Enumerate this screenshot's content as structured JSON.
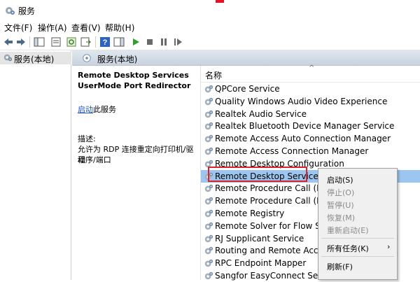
{
  "window": {
    "title": "服务"
  },
  "menu": [
    "文件(F)",
    "操作(A)",
    "查看(V)",
    "帮助(H)"
  ],
  "tree": {
    "node_label": "服务(本地)"
  },
  "pane": {
    "header_label": "服务(本地)"
  },
  "details": {
    "service_name_line1": "Remote Desktop Services",
    "service_name_line2": "UserMode Port Redirector",
    "start_link": "启动",
    "start_suffix": "此服务",
    "desc_label": "描述:",
    "desc_line1": "允许为 RDP 连接重定向打印机/驱动",
    "desc_line2": "程序/端口"
  },
  "list": {
    "column_name": "名称",
    "rows": [
      "QPCore Service",
      "Quality Windows Audio Video Experience",
      "Realtek Audio Service",
      "Realtek Bluetooth Device Manager Service",
      "Remote Access Auto Connection Manager",
      "Remote Access Connection Manager",
      "Remote Desktop Configuration",
      "Remote Desktop Services",
      "Remote Procedure Call (RP",
      "Remote Procedure Call (RP",
      "Remote Registry",
      "Remote Solver for Flow Sir",
      "RJ Supplicant Service",
      "Routing and Remote Acces",
      "RPC Endpoint Mapper",
      "Sangfor EasyConnect Secu"
    ],
    "selected_index": 7
  },
  "context_menu": {
    "start": "启动(S)",
    "stop": "停止(O)",
    "pause": "暂停(U)",
    "resume": "恢复(M)",
    "restart": "重新启动(E)",
    "all_tasks": "所有任务(K)",
    "all_tasks_arrow": "›",
    "refresh": "刷新(F)"
  },
  "colors": {
    "selection": "#9cc6f0",
    "highlight_box": "#d9242d",
    "link": "#1c51b7"
  }
}
